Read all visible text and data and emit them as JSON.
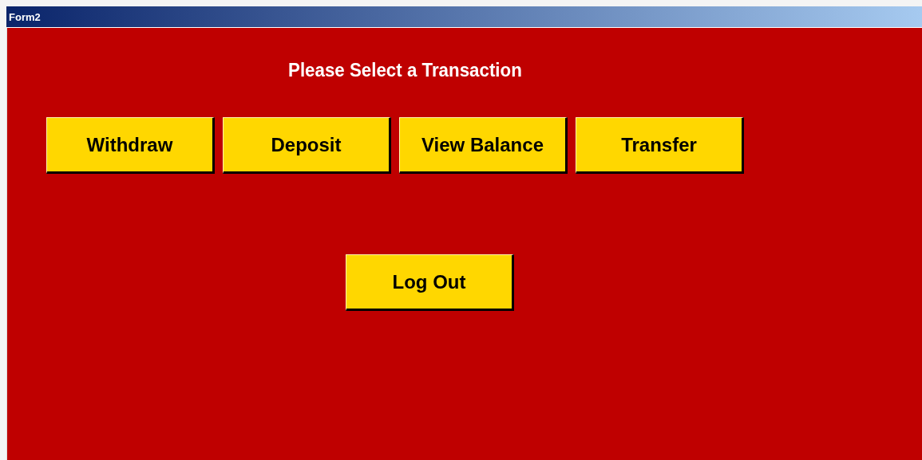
{
  "window": {
    "title": "Form2"
  },
  "heading": "Please Select a Transaction",
  "transactions": [
    "Withdraw",
    "Deposit",
    "View Balance",
    "Transfer"
  ],
  "logout": "Log Out"
}
